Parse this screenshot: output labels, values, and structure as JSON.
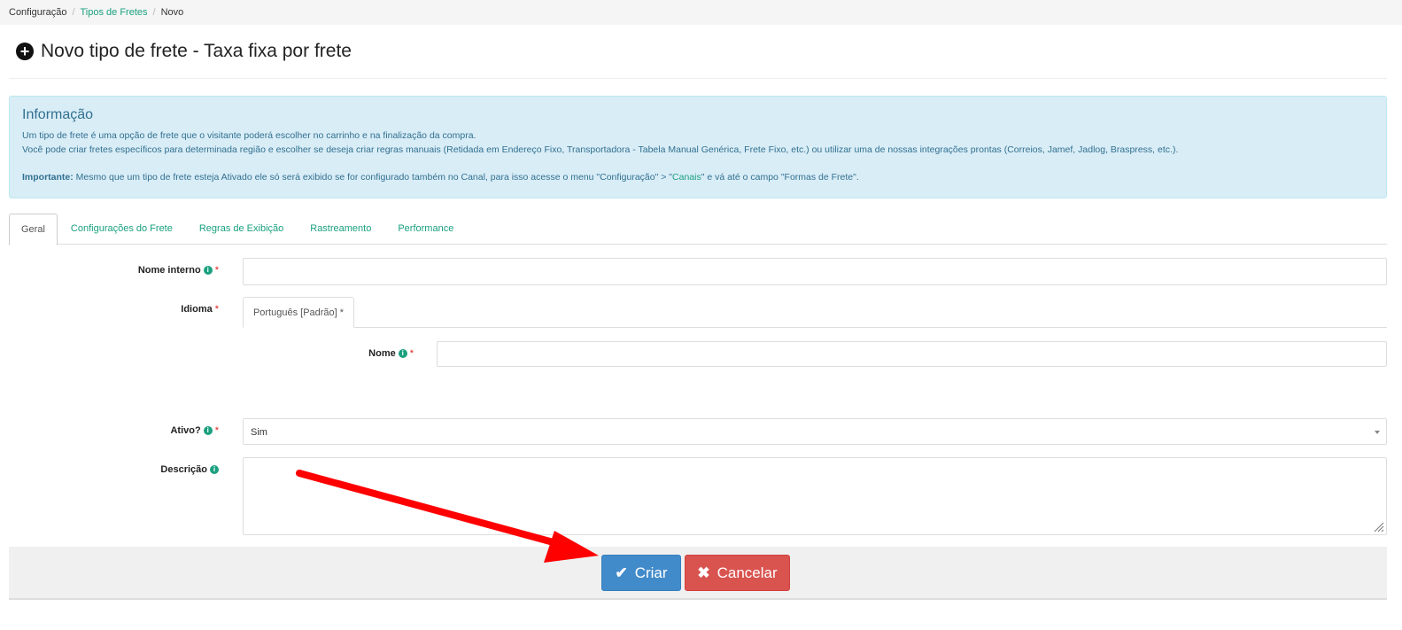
{
  "breadcrumb": {
    "items": [
      {
        "label": "Configuração"
      },
      {
        "label": "Tipos de Fretes"
      },
      {
        "label": "Novo"
      }
    ]
  },
  "page": {
    "title": "Novo tipo de frete - Taxa fixa por frete",
    "title_icon": "plus-circle-icon"
  },
  "info": {
    "heading": "Informação",
    "line1": "Um tipo de frete é uma opção de frete que o visitante poderá escolher no carrinho e na finalização da compra.",
    "line2": "Você pode criar fretes específicos para determinada região e escolher se deseja criar regras manuais (Retidada em Endereço Fixo, Transportadora - Tabela Manual Genérica, Frete Fixo, etc.) ou utilizar uma de nossas integrações prontas (Correios, Jamef, Jadlog, Braspress, etc.).",
    "important_label": "Importante:",
    "important_text_a": " Mesmo que um tipo de frete esteja Ativado ele só será exibido se for configurado também no Canal, para isso acesse o menu \"Configuração\" > \"",
    "important_link": "Canais",
    "important_text_b": "\" e vá até o campo \"Formas de Frete\"."
  },
  "tabs": [
    {
      "label": "Geral",
      "active": true
    },
    {
      "label": "Configurações do Frete"
    },
    {
      "label": "Regras de Exibição"
    },
    {
      "label": "Rastreamento"
    },
    {
      "label": "Performance"
    }
  ],
  "form": {
    "internal_name": {
      "label": "Nome interno",
      "value": ""
    },
    "language": {
      "label": "Idioma",
      "tab": "Português [Padrão] *"
    },
    "name": {
      "label": "Nome",
      "value": ""
    },
    "active": {
      "label": "Ativo?",
      "value": "Sim"
    },
    "description": {
      "label": "Descrição",
      "value": ""
    },
    "required_mark": "*"
  },
  "buttons": {
    "create": "Criar",
    "cancel": "Cancelar"
  },
  "colors": {
    "accent": "#1aa07f",
    "info_bg": "#d9edf7",
    "primary": "#428bca",
    "danger": "#d9534f",
    "annotation_arrow": "#ff0000"
  }
}
